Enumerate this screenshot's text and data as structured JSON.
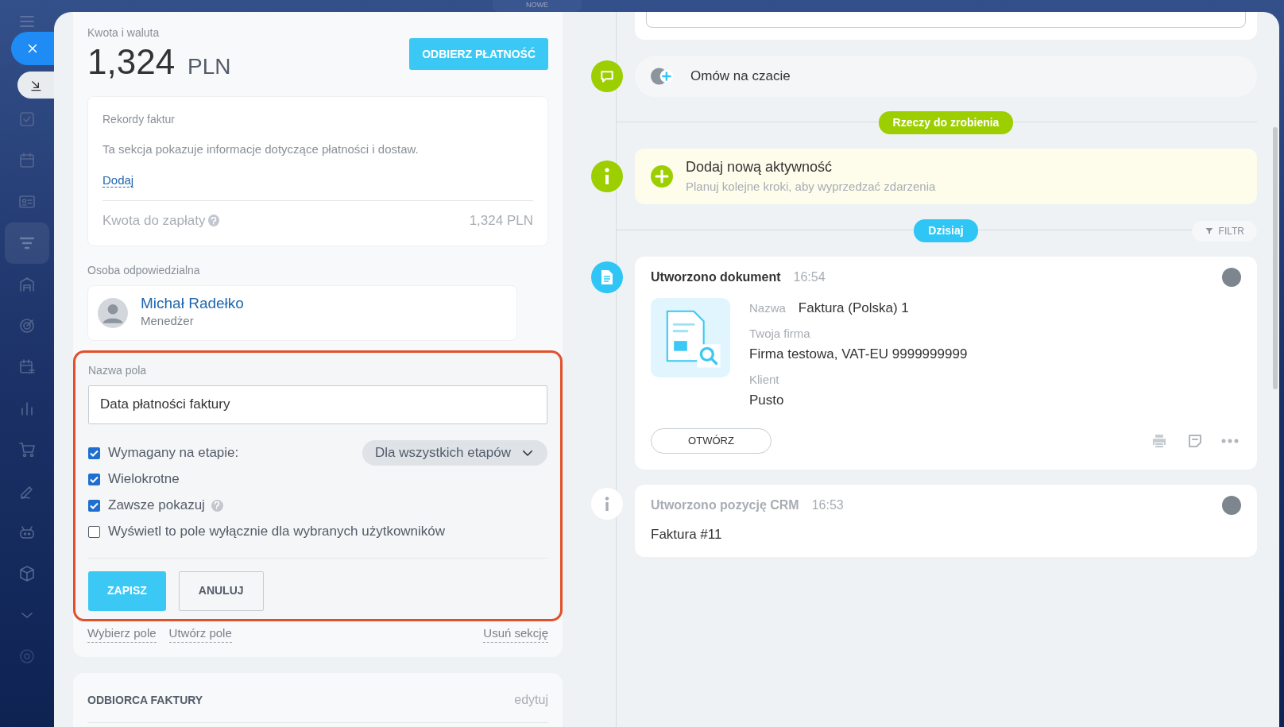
{
  "top_tab": {
    "label": "NOWE"
  },
  "sidebar": {
    "items": [
      {
        "selected": false
      },
      {
        "selected": false
      },
      {
        "selected": false
      },
      {
        "selected": true
      },
      {
        "selected": false
      },
      {
        "selected": false
      },
      {
        "selected": false
      },
      {
        "selected": false
      },
      {
        "selected": false
      },
      {
        "selected": false
      },
      {
        "selected": false
      },
      {
        "selected": false
      },
      {
        "selected": false
      },
      {
        "selected": false
      }
    ]
  },
  "amount": {
    "label": "Kwota i waluta",
    "value": "1,324",
    "currency": "PLN",
    "button": "ODBIERZ PŁATNOŚĆ"
  },
  "invoice_records": {
    "title": "Rekordy faktur",
    "description": "Ta sekcja pokazuje informacje dotyczące płatności i dostaw.",
    "add_link": "Dodaj",
    "due_label": "Kwota do zapłaty",
    "due_value": "1,324 PLN"
  },
  "responsible": {
    "label": "Osoba odpowiedzialna",
    "name": "Michał Radełko",
    "role": "Menedżer"
  },
  "field_editor": {
    "label": "Nazwa pola",
    "value": "Data płatności faktury",
    "options": [
      {
        "label": "Wymagany na etapie:",
        "checked": true,
        "dropdown": "Dla wszystkich etapów"
      },
      {
        "label": "Wielokrotne",
        "checked": true
      },
      {
        "label": "Zawsze pokazuj",
        "checked": true,
        "help": true
      },
      {
        "label": "Wyświetl to pole wyłącznie dla wybranych użytkowników",
        "checked": false
      }
    ],
    "buttons": [
      {
        "label": "ZAPISZ",
        "kind": "primary"
      },
      {
        "label": "ANULUJ",
        "kind": "secondary"
      }
    ]
  },
  "section_links": [
    "Wybierz pole",
    "Utwórz pole"
  ],
  "remove_link": "Usuń sekcję",
  "recipient": {
    "title": "ODBIORCA FAKTURY",
    "edit": "edytuj"
  },
  "timeline": {
    "chat": "Omów na czacie",
    "todo_label": "Rzeczy do zrobienia",
    "add_activity": {
      "title": "Dodaj nową aktywność",
      "subtitle": "Planuj kolejne kroki, aby wyprzedzać zdarzenia"
    },
    "today_label": "Dzisiaj",
    "filter": "FILTR",
    "events": [
      {
        "kind": "document",
        "title": "Utworzono dokument",
        "time": "16:54",
        "fields": [
          {
            "label": "Nazwa",
            "value": "Faktura (Polska) 1",
            "inline": true
          },
          {
            "label": "Twoja firma",
            "value": "Firma testowa, VAT-EU 9999999999",
            "inline": false
          },
          {
            "label": "Klient",
            "value": "Pusto",
            "inline": false
          }
        ],
        "button": "OTWÓRZ"
      },
      {
        "kind": "crm",
        "title": "Utworzono pozycję CRM",
        "time": "16:53",
        "text": "Faktura #11"
      }
    ]
  }
}
